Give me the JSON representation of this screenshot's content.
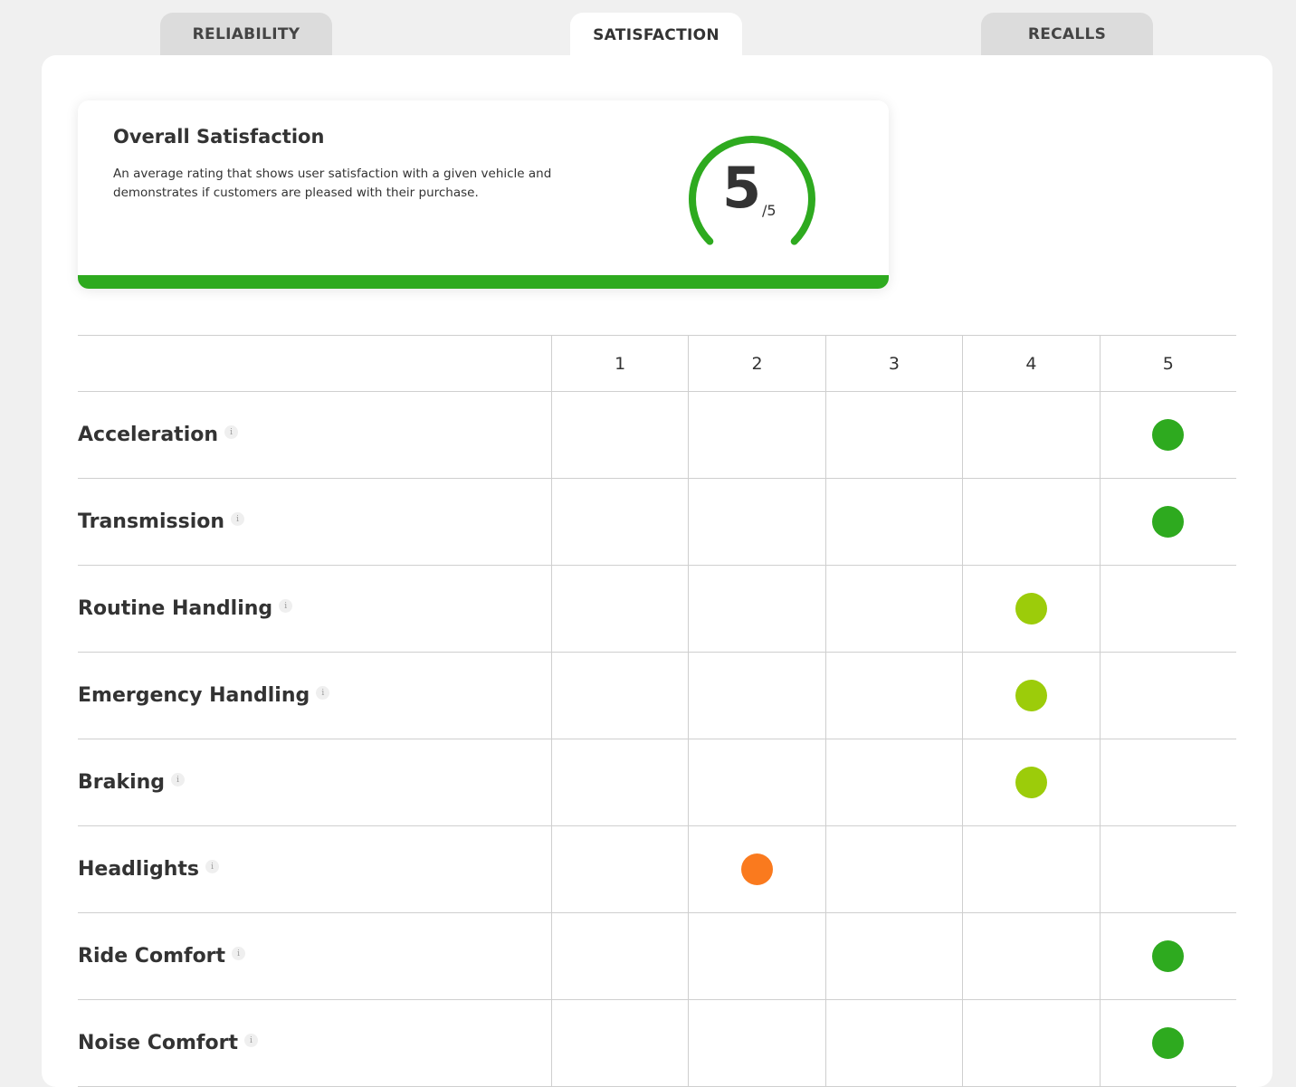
{
  "tabs": [
    {
      "label": "RELIABILITY",
      "active": false
    },
    {
      "label": "SATISFACTION",
      "active": true
    },
    {
      "label": "RECALLS",
      "active": false
    }
  ],
  "overall": {
    "title": "Overall Satisfaction",
    "description": "An average rating that shows user satisfaction with a given vehicle and demonstrates if customers are pleased with their purchase.",
    "score": "5",
    "max_label": "/5",
    "score_fraction": 1.0,
    "accent_color": "#2eaa1f"
  },
  "columns": [
    "1",
    "2",
    "3",
    "4",
    "5"
  ],
  "rating_colors": {
    "1": "#e8351f",
    "2": "#fa7a1e",
    "3": "#f2c200",
    "4": "#9ccc0a",
    "5": "#2eaa1f"
  },
  "rows": [
    {
      "label": "Acceleration",
      "rating": 5
    },
    {
      "label": "Transmission",
      "rating": 5
    },
    {
      "label": "Routine Handling",
      "rating": 4
    },
    {
      "label": "Emergency Handling",
      "rating": 4
    },
    {
      "label": "Braking",
      "rating": 4
    },
    {
      "label": "Headlights",
      "rating": 2
    },
    {
      "label": "Ride Comfort",
      "rating": 5
    },
    {
      "label": "Noise Comfort",
      "rating": 5
    }
  ],
  "info_icon_glyph": "i"
}
